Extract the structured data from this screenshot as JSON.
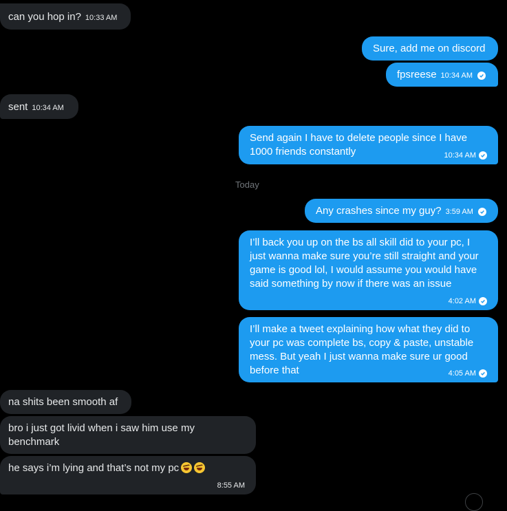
{
  "conversation": {
    "day_divider": "Today",
    "messages": [
      {
        "text": "can you hop in?",
        "time": "10:33 AM"
      },
      {
        "text": "Sure, add me on discord"
      },
      {
        "text": "fpsreese",
        "time": "10:34 AM"
      },
      {
        "text": "sent",
        "time": "10:34 AM"
      },
      {
        "text_lines": [
          "Send again I have to delete people since I have",
          "1000 friends constantly"
        ],
        "time": "10:34 AM"
      },
      {
        "text": "Any crashes since my guy?",
        "time": "3:59 AM"
      },
      {
        "text_lines": [
          "I’ll back you up on the bs all skill did to your pc, I",
          "just wanna make sure you’re still straight and your",
          "game is good lol, I would assume you would have",
          "said something by now if there was an issue"
        ],
        "time": "4:02 AM"
      },
      {
        "text_lines": [
          "I’ll make a tweet explaining how what they did to",
          "your pc was complete bs, copy & paste, unstable",
          "mess. But yeah I just wanna make sure ur good",
          "before that"
        ],
        "time": "4:05 AM"
      },
      {
        "text": "na shits been smooth af"
      },
      {
        "text_lines": [
          "bro i just got livid when i saw him use my",
          "benchmark"
        ]
      },
      {
        "text": "he says i’m lying and that’s not my pc",
        "emojis": [
          "rolling-on-floor-laughing-icon",
          "rolling-on-floor-laughing-icon"
        ],
        "time": "8:55 AM"
      }
    ]
  },
  "colors": {
    "background": "#000000",
    "incoming_bubble": "#202327",
    "outgoing_bubble": "#1d9bf0",
    "divider_text": "#71767b"
  }
}
